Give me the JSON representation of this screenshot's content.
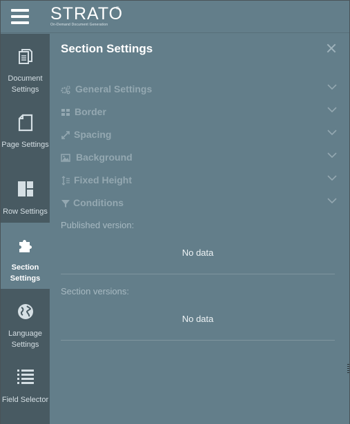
{
  "header": {
    "logo_text": "STRATO",
    "logo_registered": "®",
    "logo_tagline": "On-Demand Document Generation",
    "menu_icon": "hamburger-menu-icon"
  },
  "sidebar": {
    "items": [
      {
        "label": "Document Settings",
        "icon": "document-copy-icon",
        "active": false
      },
      {
        "label": "Page Settings",
        "icon": "page-icon",
        "active": false
      },
      {
        "label": "Row Settings",
        "icon": "row-layout-icon",
        "active": false
      },
      {
        "label": "Section Settings",
        "icon": "puzzle-piece-icon",
        "active": true
      },
      {
        "label": "Language Settings",
        "icon": "globe-icon",
        "active": false
      },
      {
        "label": "Field Selector",
        "icon": "list-icon",
        "active": false
      }
    ]
  },
  "panel": {
    "title": "Section Settings",
    "close_icon": "close-icon",
    "accordion": [
      {
        "label": "General Settings",
        "icon": "gears-icon"
      },
      {
        "label": "Border",
        "icon": "border-grid-icon"
      },
      {
        "label": "Spacing",
        "icon": "expand-arrows-icon"
      },
      {
        "label": "Background",
        "icon": "image-icon"
      },
      {
        "label": "Fixed Height",
        "icon": "vertical-resize-icon"
      },
      {
        "label": "Conditions",
        "icon": "filter-icon"
      }
    ],
    "published_label": "Published version:",
    "published_value": "No data",
    "versions_label": "Section versions:",
    "versions_value": "No data"
  },
  "colors": {
    "panel_bg": "#637e8a",
    "sidebar_bg": "#485a62",
    "muted_text": "#94a8b1",
    "white": "#ffffff"
  }
}
